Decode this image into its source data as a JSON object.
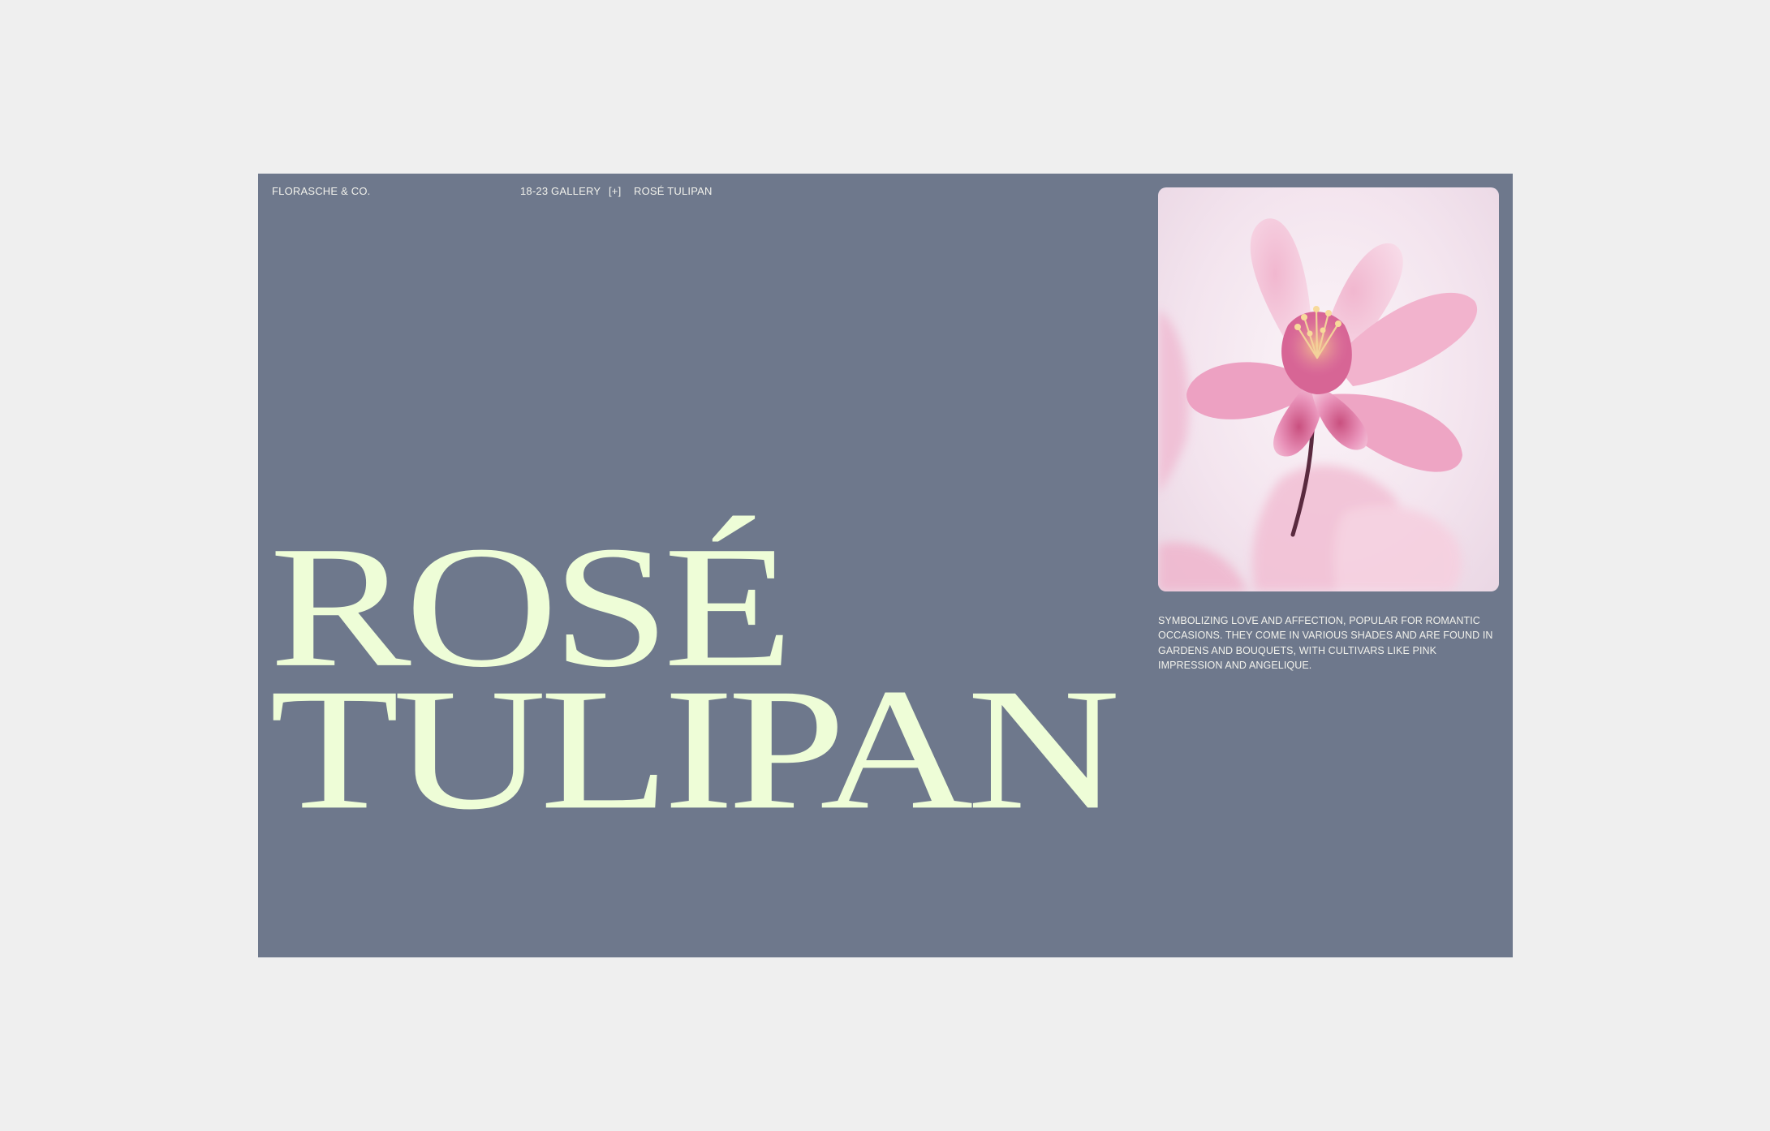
{
  "header": {
    "brand": "FLORASCHE & CO.",
    "gallery_label": "18-23 GALLERY",
    "toggle_label": "[+]",
    "current_item": "ROSÉ TULIPAN"
  },
  "hero": {
    "title_line1": "ROSÉ",
    "title_line2": "TULIPAN"
  },
  "feature": {
    "image_subject": "pink-flower-photo",
    "description": "SYMBOLIZING LOVE AND AFFECTION, POPULAR FOR ROMANTIC OCCASIONS. THEY COME IN VARIOUS SHADES AND ARE FOUND IN GARDENS AND BOUQUETS, WITH CULTIVARS LIKE PINK IMPRESSION AND ANGELIQUE."
  },
  "colors": {
    "page_background": "#efefef",
    "panel_background": "#6e788c",
    "headline": "#eefdd7",
    "small_text": "#f2f2ec",
    "flower_pink": "#e58fb4",
    "flower_magenta": "#b63b76"
  }
}
